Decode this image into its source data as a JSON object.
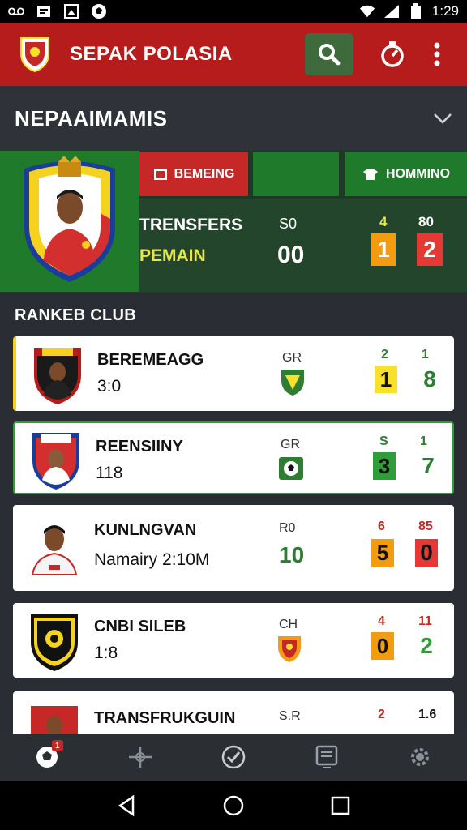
{
  "status": {
    "time": "1:29"
  },
  "appbar": {
    "title": "SEPAK POLASIA"
  },
  "section": {
    "title": "NEPAAIMAMIS"
  },
  "hero": {
    "tab1": "BEMEING",
    "tab3": "HOMMINO",
    "line1": "TRENSFERS",
    "line2": "PEMAIN",
    "stat_label": "S0",
    "stat_value": "00",
    "n1": "4",
    "n2": "80",
    "b1": "1",
    "b2": "2"
  },
  "ranked_label": "RANKEB CLUB",
  "cards": [
    {
      "name": "BEREMEAGG",
      "sub": "3:0",
      "code": "GR",
      "n1": "2",
      "n2": "1",
      "b1": "1",
      "b2": "8",
      "n1_color": "#2e7d32",
      "n2_color": "#2e7d32",
      "b1_bg": "#f9e02b",
      "b1_fg": "#111",
      "b2_bg": "#ffffff",
      "b2_fg": "#2e7d32"
    },
    {
      "name": "REENSIINY",
      "sub": "118",
      "code": "GR",
      "n1": "S",
      "n2": "1",
      "b1": "3",
      "b2": "7",
      "n1_color": "#2e7d32",
      "n2_color": "#2e7d32",
      "b1_bg": "#2e9d3a",
      "b1_fg": "#111",
      "b2_bg": "#ffffff",
      "b2_fg": "#2e7d32"
    },
    {
      "name": "KUNLNGVAN",
      "sub": "Namairy 2:10M",
      "code": "R0",
      "big": "10",
      "n1": "6",
      "n2": "85",
      "b1": "5",
      "b2": "0",
      "n1_color": "#c62828",
      "n2_color": "#c62828",
      "b1_bg": "#f39c12",
      "b1_fg": "#111",
      "b2_bg": "#e53935",
      "b2_fg": "#111"
    },
    {
      "name": "CNBI SILEB",
      "sub": "1:8",
      "code": "CH",
      "n1": "4",
      "n2": "11",
      "b1": "0",
      "b2": "2",
      "n1_color": "#c62828",
      "n2_color": "#c62828",
      "b1_bg": "#f39c12",
      "b1_fg": "#111",
      "b2_bg": "#ffffff",
      "b2_fg": "#2e9d3a"
    },
    {
      "name": "TRANSFRUKGUIN",
      "sub": "",
      "code": "S.R",
      "n1": "2",
      "n2": "1.6",
      "b1": "",
      "b2": "",
      "n1_color": "#c62828",
      "n2_color": "#111",
      "b1_bg": "#f39c12",
      "b1_fg": "#111",
      "b2_bg": "#f39c12",
      "b2_fg": "#111"
    }
  ],
  "nav": {
    "badge": "1"
  },
  "colors": {
    "appbar": "#b71c1c",
    "green": "#1f7a2b",
    "red": "#c62828",
    "orange": "#f39c12",
    "yellow": "#f9e02b"
  }
}
